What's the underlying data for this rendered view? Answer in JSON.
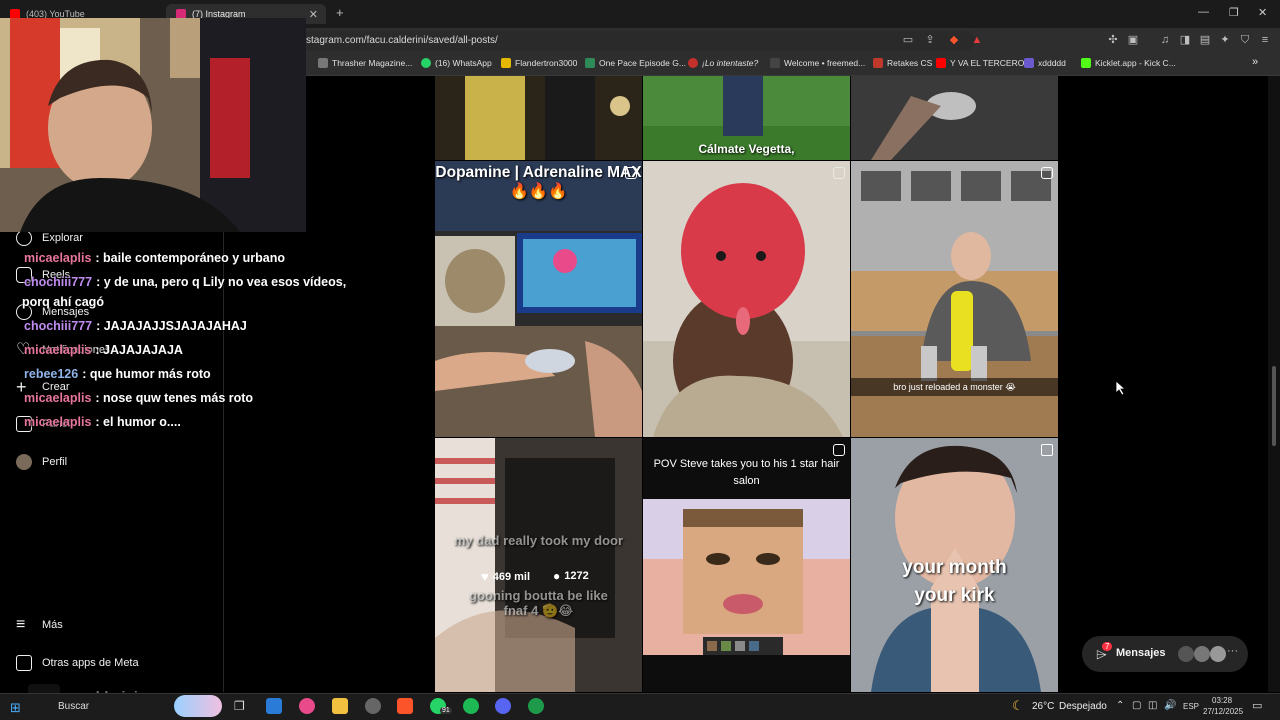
{
  "browser": {
    "tabs": [
      {
        "label": "(403) YouTube",
        "favicon_color": "#ff0000"
      },
      {
        "label": "(7) Instagram",
        "favicon_color": "#d62976"
      }
    ],
    "new_tab": "+",
    "url": "stagram.com/facu.calderini/saved/all-posts/",
    "window_controls": [
      "—",
      "❐",
      "✕"
    ],
    "bookmarks": [
      {
        "label": "Thrasher Magazine...",
        "color": "#777777"
      },
      {
        "label": "(16) WhatsApp",
        "color": "#25d366"
      },
      {
        "label": "Flandertron3000",
        "color": "#e6b800"
      },
      {
        "label": "One Pace Episode G...",
        "color": "#2e8b57"
      },
      {
        "label": "¡Lo intentaste?",
        "color": "#c4302b"
      },
      {
        "label": "Welcome • freemed...",
        "color": "#444444"
      },
      {
        "label": "Retakes CS",
        "color": "#c0392b"
      },
      {
        "label": "Y VA EL TERCERO",
        "color": "#ff0000"
      },
      {
        "label": "xddddd",
        "color": "#6a5acd"
      },
      {
        "label": "Kicklet.app - Kick C...",
        "color": "#53fc18"
      }
    ],
    "more": "»"
  },
  "sidebar": {
    "items": [
      {
        "label": "Explorar",
        "icon": "compass-icon"
      },
      {
        "label": "Reels",
        "icon": "reels-icon"
      },
      {
        "label": "Mensajes",
        "icon": "messenger-icon"
      },
      {
        "label": "Notificaciones",
        "icon": "heart-icon"
      },
      {
        "label": "Crear",
        "icon": "plus-icon"
      },
      {
        "label": "Panel",
        "icon": "dashboard-icon"
      },
      {
        "label": "Perfil",
        "icon": "avatar"
      }
    ],
    "bottom": [
      {
        "label": "Más",
        "icon": "menu-icon"
      },
      {
        "label": "Otras apps de Meta",
        "icon": "grid-icon"
      }
    ]
  },
  "chat": [
    {
      "user": "micaelaplis",
      "text": ": baile contemporáneo y urbano",
      "color": "#e8769a"
    },
    {
      "user": "chochiii777",
      "text": ": y de una, pero q Lily no vea esos vídeos,",
      "color": "#c18cf0"
    },
    {
      "user": "",
      "text": "porq ahí cagó",
      "color": "#ffffff"
    },
    {
      "user": "chochiii777",
      "text": ": JAJAJAJJSJAJAJAHAJ",
      "color": "#c18cf0"
    },
    {
      "user": "micaelaplis",
      "text": ": JAJAJAJAJA",
      "color": "#e8769a"
    },
    {
      "user": "rebee126",
      "text": ": que humor más roto",
      "color": "#8fb4e8"
    },
    {
      "user": "micaelaplis",
      "text": ": nose quw tenes más roto",
      "color": "#e8769a"
    },
    {
      "user": "micaelaplis",
      "text": ": el humor o....",
      "color": "#e8769a"
    }
  ],
  "posts": {
    "row2": [
      {
        "caption": "Dopamine | Adrenaline MAX 🔥🔥🔥"
      },
      {
        "caption": ""
      },
      {
        "caption": "bro just reloaded a monster 😭"
      }
    ],
    "row1_caption": "Cálmate Vegetta,",
    "row3": [
      {
        "caption": "my dad really took my door",
        "caption2": "gooning boutta be like fnaf 4 🫡😂",
        "likes": "469 mil",
        "comments": "1272"
      },
      {
        "caption": "POV Steve takes you to his 1 star hair salon"
      },
      {
        "caption": "your month your kirk"
      }
    ]
  },
  "messages_pill": {
    "label": "Mensajes",
    "badge": "7",
    "more": "···"
  },
  "overlay_username": "cu.calderini",
  "taskbar": {
    "search": "Buscar",
    "weather_temp": "26°C",
    "weather_desc": "Despejado",
    "lang": "ESP",
    "time": "03:28",
    "date": "27/12/2025",
    "whatsapp_badge": "91"
  }
}
